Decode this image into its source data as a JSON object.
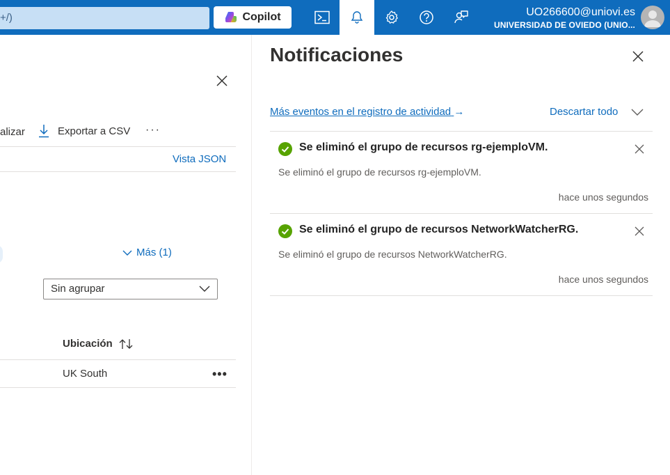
{
  "topbar": {
    "search_text": "+/)",
    "copilot_label": "Copilot",
    "account_email": "UO266600@uniovi.es",
    "account_org": "UNIVERSIDAD DE OVIEDO (UNIO...",
    "accent": "#0f6cbd"
  },
  "left_blade": {
    "refresh_label": "alizar",
    "export_label": "Exportar a CSV",
    "more_dots": "···",
    "json_view": "Vista JSON",
    "filters_more": "Más (1)",
    "grouping": "Sin agrupar",
    "column_location": "Ubicación",
    "row_location": "UK South",
    "row_menu": "•••"
  },
  "panel": {
    "title": "Notificaciones",
    "activity_link": "Más eventos en el registro de actividad",
    "activity_arrow": "→",
    "dismiss_all": "Descartar todo",
    "notifications": [
      {
        "title": "Se eliminó el grupo de recursos rg-ejemploVM.",
        "body": "Se eliminó el grupo de recursos rg-ejemploVM.",
        "time": "hace unos segundos",
        "status_color": "#57a300"
      },
      {
        "title": "Se eliminó el grupo de recursos NetworkWatcherRG.",
        "body": "Se eliminó el grupo de recursos NetworkWatcherRG.",
        "time": "hace unos segundos",
        "status_color": "#57a300"
      }
    ]
  }
}
